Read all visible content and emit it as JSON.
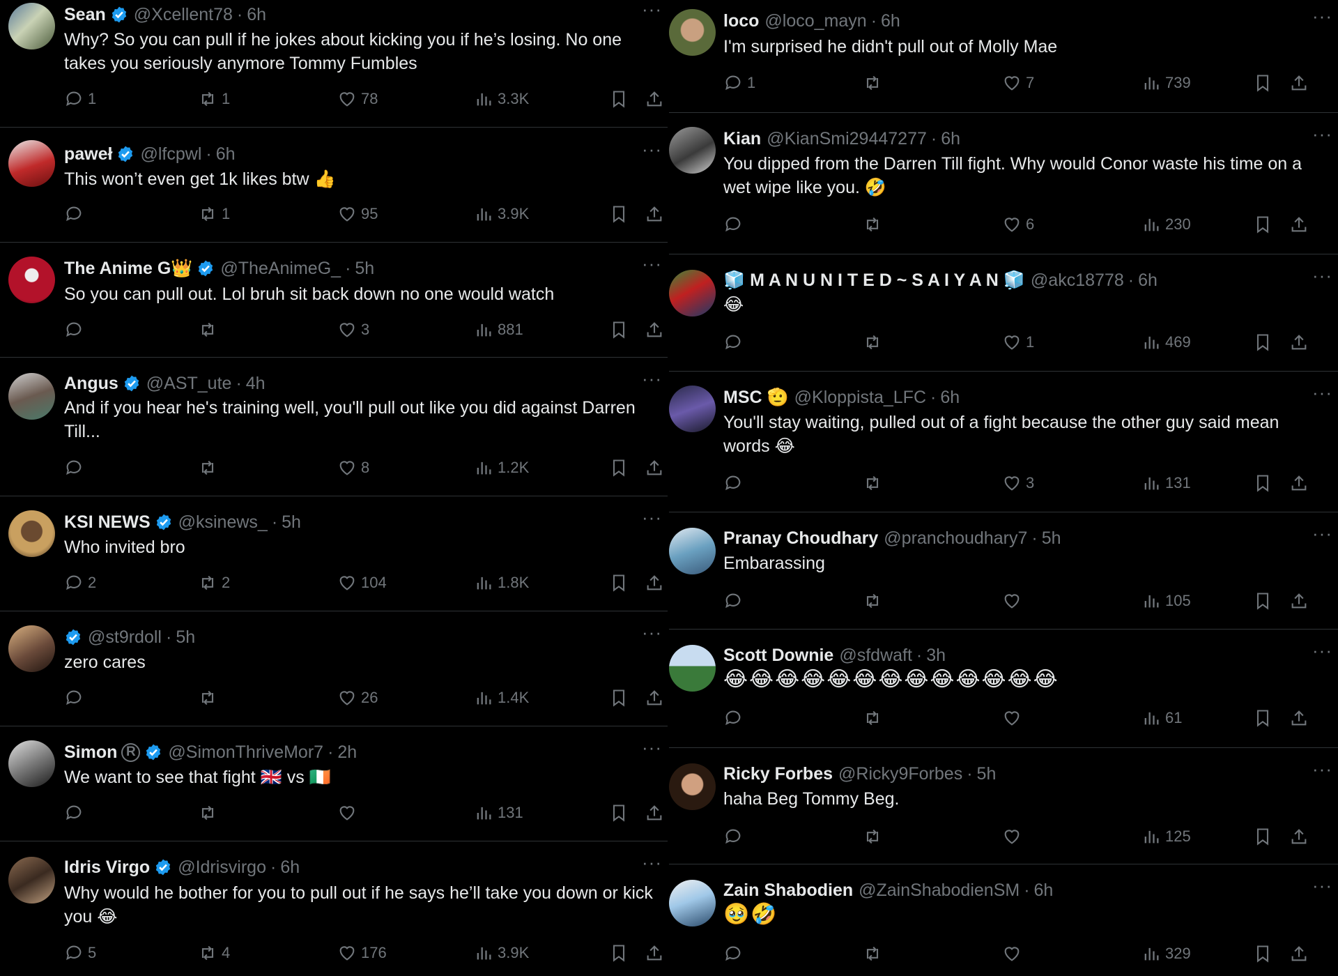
{
  "colors": {
    "background": "#000000",
    "text": "#e7e9ea",
    "muted": "#71767b",
    "verified": "#1d9bf0",
    "divider": "#2f3336"
  },
  "left": [
    {
      "name": "Sean",
      "verified": true,
      "handle": "@Xcellent78",
      "time": "6h",
      "text": "Why? So you can pull if he jokes about kicking you if he’s losing. No one takes you seriously anymore Tommy Fumbles",
      "replies": "1",
      "retweets": "1",
      "likes": "78",
      "views": "3.3K"
    },
    {
      "name": "paweł",
      "verified": true,
      "handle": "@lfcpwl",
      "time": "6h",
      "text": "This won’t even get 1k likes btw 👍",
      "replies": "",
      "retweets": "1",
      "likes": "95",
      "views": "3.9K"
    },
    {
      "name": "The Anime G👑",
      "verified": true,
      "handle": "@TheAnimeG_",
      "time": "5h",
      "text": "So you can pull out. Lol bruh sit back down no one would watch",
      "replies": "",
      "retweets": "",
      "likes": "3",
      "views": "881"
    },
    {
      "name": "Angus",
      "verified": true,
      "handle": "@AST_ute",
      "time": "4h",
      "text": "And if you hear he's training well, you'll pull out like you did against Darren Till...",
      "replies": "",
      "retweets": "",
      "likes": "8",
      "views": "1.2K"
    },
    {
      "name": "KSI NEWS",
      "verified": true,
      "handle": "@ksinews_",
      "time": "5h",
      "text": "Who invited bro",
      "replies": "2",
      "retweets": "2",
      "likes": "104",
      "views": "1.8K"
    },
    {
      "name": "",
      "verified": true,
      "handle": "@st9rdoll",
      "time": "5h",
      "text": "zero cares",
      "replies": "",
      "retweets": "",
      "likes": "26",
      "views": "1.4K"
    },
    {
      "name": "Simon",
      "verified": true,
      "handle": "@SimonThriveMor7",
      "time": "2h",
      "text": "We want to see that fight 🇬🇧 vs 🇮🇪",
      "replies": "",
      "retweets": "",
      "likes": "",
      "views": "131"
    },
    {
      "name": "Idris Virgo",
      "verified": true,
      "handle": "@Idrisvirgo",
      "time": "6h",
      "text": "Why would he bother for you to pull out if he says he’ll take you down or kick you 😂",
      "replies": "5",
      "retweets": "4",
      "likes": "176",
      "views": "3.9K"
    }
  ],
  "right": [
    {
      "name": "loco",
      "verified": false,
      "handle": "@loco_mayn",
      "time": "6h",
      "text": "I'm surprised he didn't pull out of Molly Mae",
      "replies": "1",
      "retweets": "",
      "likes": "7",
      "views": "739"
    },
    {
      "name": "Kian",
      "verified": false,
      "handle": "@KianSmi29447277",
      "time": "6h",
      "text": "You dipped from the Darren Till fight. Why would Conor waste his time on a wet wipe like you. 🤣",
      "replies": "",
      "retweets": "",
      "likes": "6",
      "views": "230"
    },
    {
      "name": "🧊 M A N U N I T E D ~ S A I Y A N 🧊",
      "verified": false,
      "handle": "@akc18778",
      "time": "6h",
      "text": "😂",
      "replies": "",
      "retweets": "",
      "likes": "1",
      "views": "469"
    },
    {
      "name": "MSC 🫡",
      "verified": false,
      "handle": "@Kloppista_LFC",
      "time": "6h",
      "text": "You'll stay waiting, pulled out of a fight because the other guy said mean words 😂",
      "replies": "",
      "retweets": "",
      "likes": "3",
      "views": "131"
    },
    {
      "name": "Pranay Choudhary",
      "verified": false,
      "handle": "@pranchoudhary7",
      "time": "5h",
      "text": "Embarassing",
      "replies": "",
      "retweets": "",
      "likes": "",
      "views": "105"
    },
    {
      "name": "Scott Downie",
      "verified": false,
      "handle": "@sfdwaft",
      "time": "3h",
      "text": "😂😂😂😂😂😂😂😂😂😂😂😂😂",
      "replies": "",
      "retweets": "",
      "likes": "",
      "views": "61"
    },
    {
      "name": "Ricky Forbes",
      "verified": false,
      "handle": "@Ricky9Forbes",
      "time": "5h",
      "text": "haha Beg Tommy Beg.",
      "replies": "",
      "retweets": "",
      "likes": "",
      "views": "125"
    },
    {
      "name": "Zain Shabodien",
      "verified": false,
      "handle": "@ZainShabodienSM",
      "time": "6h",
      "text": "🥹🤣",
      "replies": "",
      "retweets": "",
      "likes": "",
      "views": "329"
    }
  ]
}
